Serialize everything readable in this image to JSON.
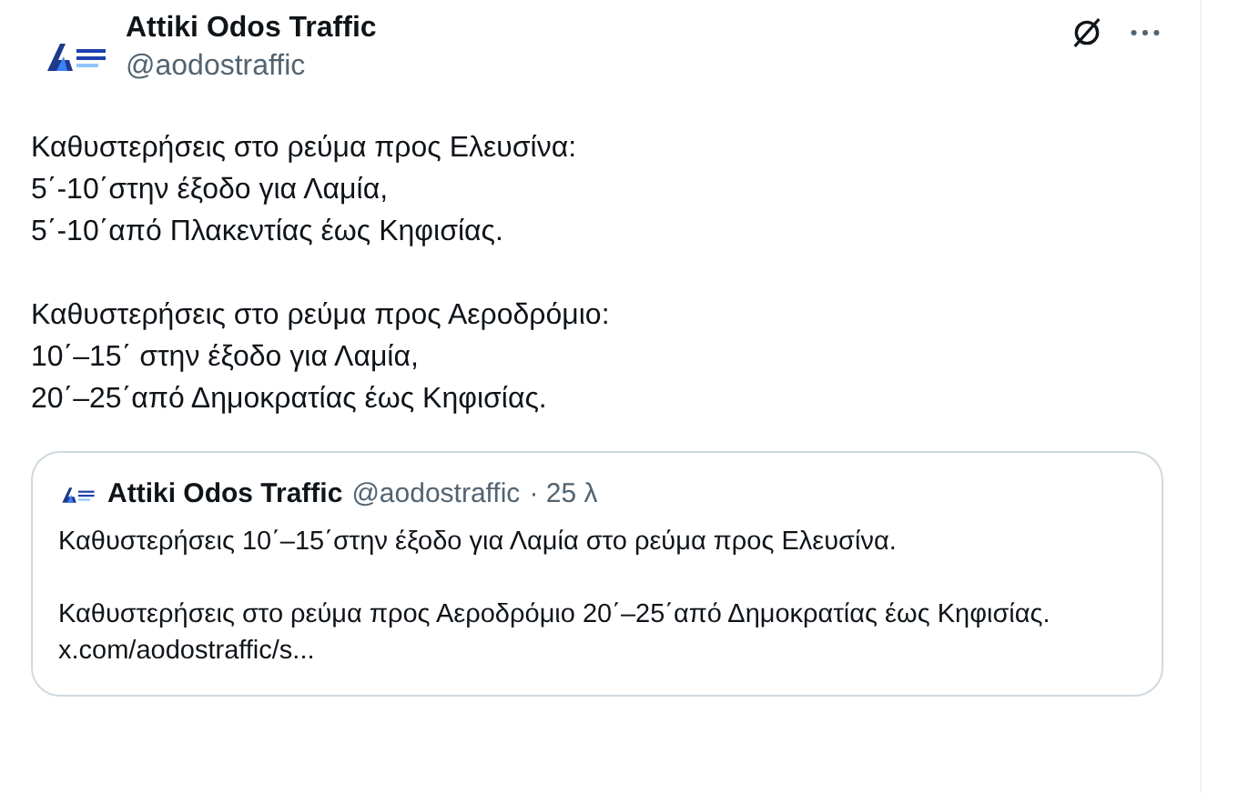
{
  "author": {
    "name": "Attiki Odos Traffic",
    "handle": "@aodostraffic"
  },
  "paragraphs": [
    [
      "Καθυστερήσεις στο ρεύμα προς Ελευσίνα:",
      "5΄-10΄στην έξοδο για Λαμία,",
      "5΄-10΄από Πλακεντίας έως Κηφισίας."
    ],
    [
      "Καθυστερήσεις στο ρεύμα προς Αεροδρόμιο:",
      "10΄–15΄ στην έξοδο για Λαμία,",
      "20΄–25΄από Δημοκρατίας έως Κηφισίας."
    ]
  ],
  "quote": {
    "name": "Attiki Odos Traffic",
    "handle": "@aodostraffic",
    "time": "· 25 λ",
    "paragraphs": [
      {
        "text": "Καθυστερήσεις 10΄–15΄στην έξοδο για Λαμία στο ρεύμα προς Ελευσίνα."
      },
      {
        "text": "Καθυστερήσεις στο ρεύμα προς Αεροδρόμιο 20΄–25΄από Δημοκρατίας έως Κηφισίας.",
        "link": "x.com/aodostraffic/s..."
      }
    ]
  }
}
